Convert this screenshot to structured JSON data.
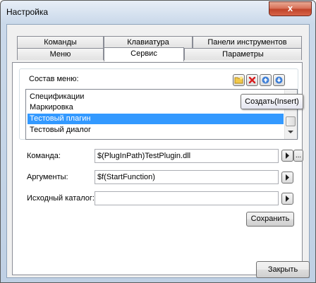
{
  "window": {
    "title": "Настройка",
    "close_glyph": "x"
  },
  "tabs": {
    "row1": [
      "Команды",
      "Клавиатура",
      "Панели инструментов"
    ],
    "row2": [
      "Меню",
      "Сервис",
      "Параметры"
    ],
    "active": "Сервис"
  },
  "menu_group": {
    "label": "Состав меню:",
    "toolbar": {
      "create_icon": "folder-create-icon",
      "delete_icon": "delete-icon",
      "up_icon": "arrow-up-icon",
      "down_icon": "arrow-down-icon"
    },
    "items": [
      "Спецификации",
      "Маркировка",
      "Тестовый плагин",
      "Тестовый диалог"
    ],
    "selected_index": 2
  },
  "tooltip": "Создать(Insert)",
  "fields": {
    "command": {
      "label": "Команда:",
      "value": "$(PlugInPath)TestPlugin.dll",
      "browse_label": "..."
    },
    "arguments": {
      "label": "Аргументы:",
      "value": "$f(StartFunction)"
    },
    "initial_dir": {
      "label": "Исходный каталог:",
      "value": ""
    }
  },
  "buttons": {
    "save": "Сохранить",
    "close": "Закрыть"
  },
  "colors": {
    "selection": "#3399ff",
    "window_frame": "#bfd0e4",
    "close_button": "#c0442a"
  }
}
